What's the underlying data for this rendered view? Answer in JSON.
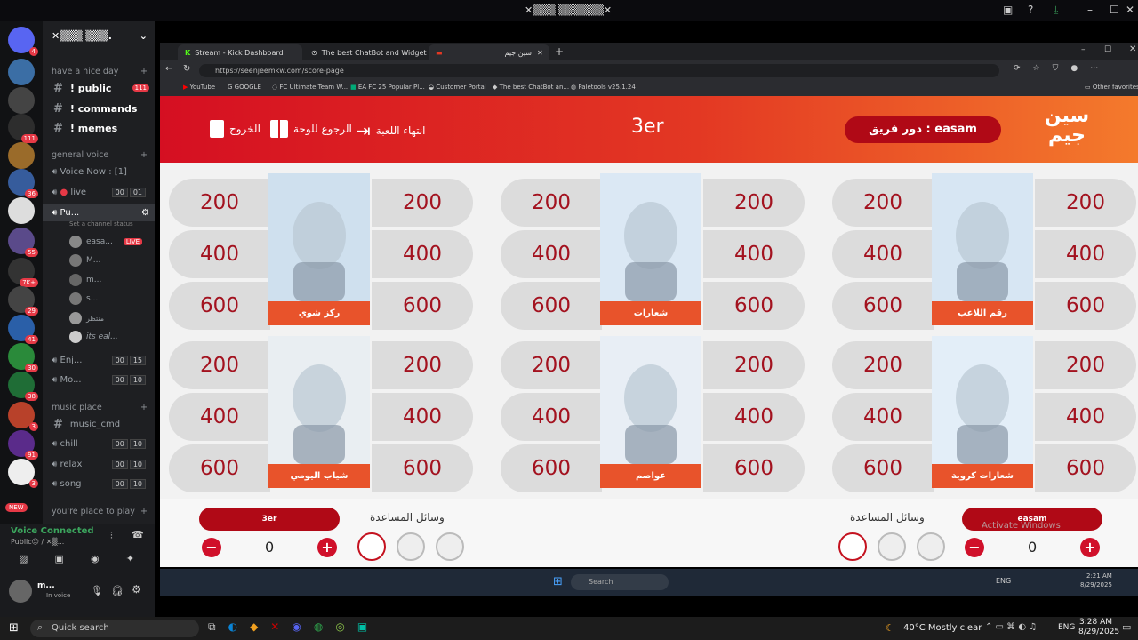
{
  "window": {
    "title": "✕▒▒▒ ▒▒▒▒▒▒✕"
  },
  "discord": {
    "server_name": "✕▒▒▒ ▒▒▒.",
    "categories": {
      "nice_day": "have a nice day",
      "general_voice": "general voice",
      "music_place": "music place",
      "place_to_play": "you're place to play"
    },
    "text_channels": [
      {
        "name": "! public",
        "badge": "111"
      },
      {
        "name": "! commands"
      },
      {
        "name": "! memes"
      }
    ],
    "voice_now": "Voice Now : [1]",
    "voice_channels": [
      {
        "name": "live",
        "count": "00",
        "limit": "01"
      },
      {
        "name": "Pu...",
        "status": "Set a channel status"
      },
      {
        "name": "Enj...",
        "count": "00",
        "limit": "15"
      },
      {
        "name": "Mo...",
        "count": "00",
        "limit": "10"
      }
    ],
    "voice_users": [
      "easa...",
      "M...",
      "m...",
      "s...",
      "منتظر",
      "its eal..."
    ],
    "live_badge": "LIVE",
    "music_channels": [
      {
        "name": "music_cmd"
      },
      {
        "name": "chill",
        "count": "00",
        "limit": "10"
      },
      {
        "name": "relax",
        "count": "00",
        "limit": "10"
      },
      {
        "name": "song",
        "count": "00",
        "limit": "10"
      }
    ],
    "server_badges": [
      "4",
      "",
      "111",
      "",
      "36",
      "",
      "",
      "55",
      "7K+",
      "29",
      "41",
      "30",
      "38",
      "3",
      "91",
      "3"
    ],
    "new_badge": "NEW",
    "voice_connected": "Voice Connected",
    "voice_location": "Public😐 / ✕▒...",
    "user": {
      "name": "m...",
      "status": "In voice"
    }
  },
  "browser": {
    "tabs": [
      {
        "label": "Stream - Kick Dashboard"
      },
      {
        "label": "The best ChatBot and Widgets fo"
      },
      {
        "label": "سين جيم"
      }
    ],
    "url": "https://seenjeemkw.com/score-page",
    "bookmarks": [
      "YouTube",
      "GOOGLE",
      "FC Ultimate Team W...",
      "EA FC 25 Popular Pl...",
      "Customer Portal",
      "The best ChatBot an...",
      "Paletools v25.1.24"
    ],
    "other_bookmarks": "Other favorites"
  },
  "game": {
    "header": {
      "end_game": "انتهاء اللعبة",
      "back_to_board": "الرجوع للوحة",
      "exit": "الخروج",
      "center": "3er",
      "turn_label": "دور فريق : easam",
      "logo": "سين جيم"
    },
    "points": [
      "200",
      "400",
      "600"
    ],
    "categories": [
      {
        "label": "ركز شوي",
        "icon": "binoculars-man-image"
      },
      {
        "label": "شعارات",
        "icon": "seen-jeem-logo-image"
      },
      {
        "label": "رقم اللاعب",
        "icon": "player-number-image"
      },
      {
        "label": "شياب اليومي",
        "icon": "old-men-image"
      },
      {
        "label": "عواصم",
        "icon": "capitals-image"
      },
      {
        "label": "شعارات كروية",
        "icon": "football-logos-image"
      }
    ],
    "teams": [
      {
        "name": "3er",
        "score": "0",
        "aids_label": "وسائل المساعدة"
      },
      {
        "name": "easam",
        "score": "0",
        "aids_label": "وسائل المساعدة"
      }
    ],
    "watermark": "Activate Windows"
  },
  "inner_taskbar": {
    "search": "Search",
    "time": "2:21 AM",
    "date": "8/29/2025",
    "lang": "ENG"
  },
  "taskbar": {
    "search": "Quick search",
    "weather": "40°C  Mostly clear",
    "lang": "ENG",
    "time": "3:28 AM",
    "date": "8/29/2025"
  }
}
